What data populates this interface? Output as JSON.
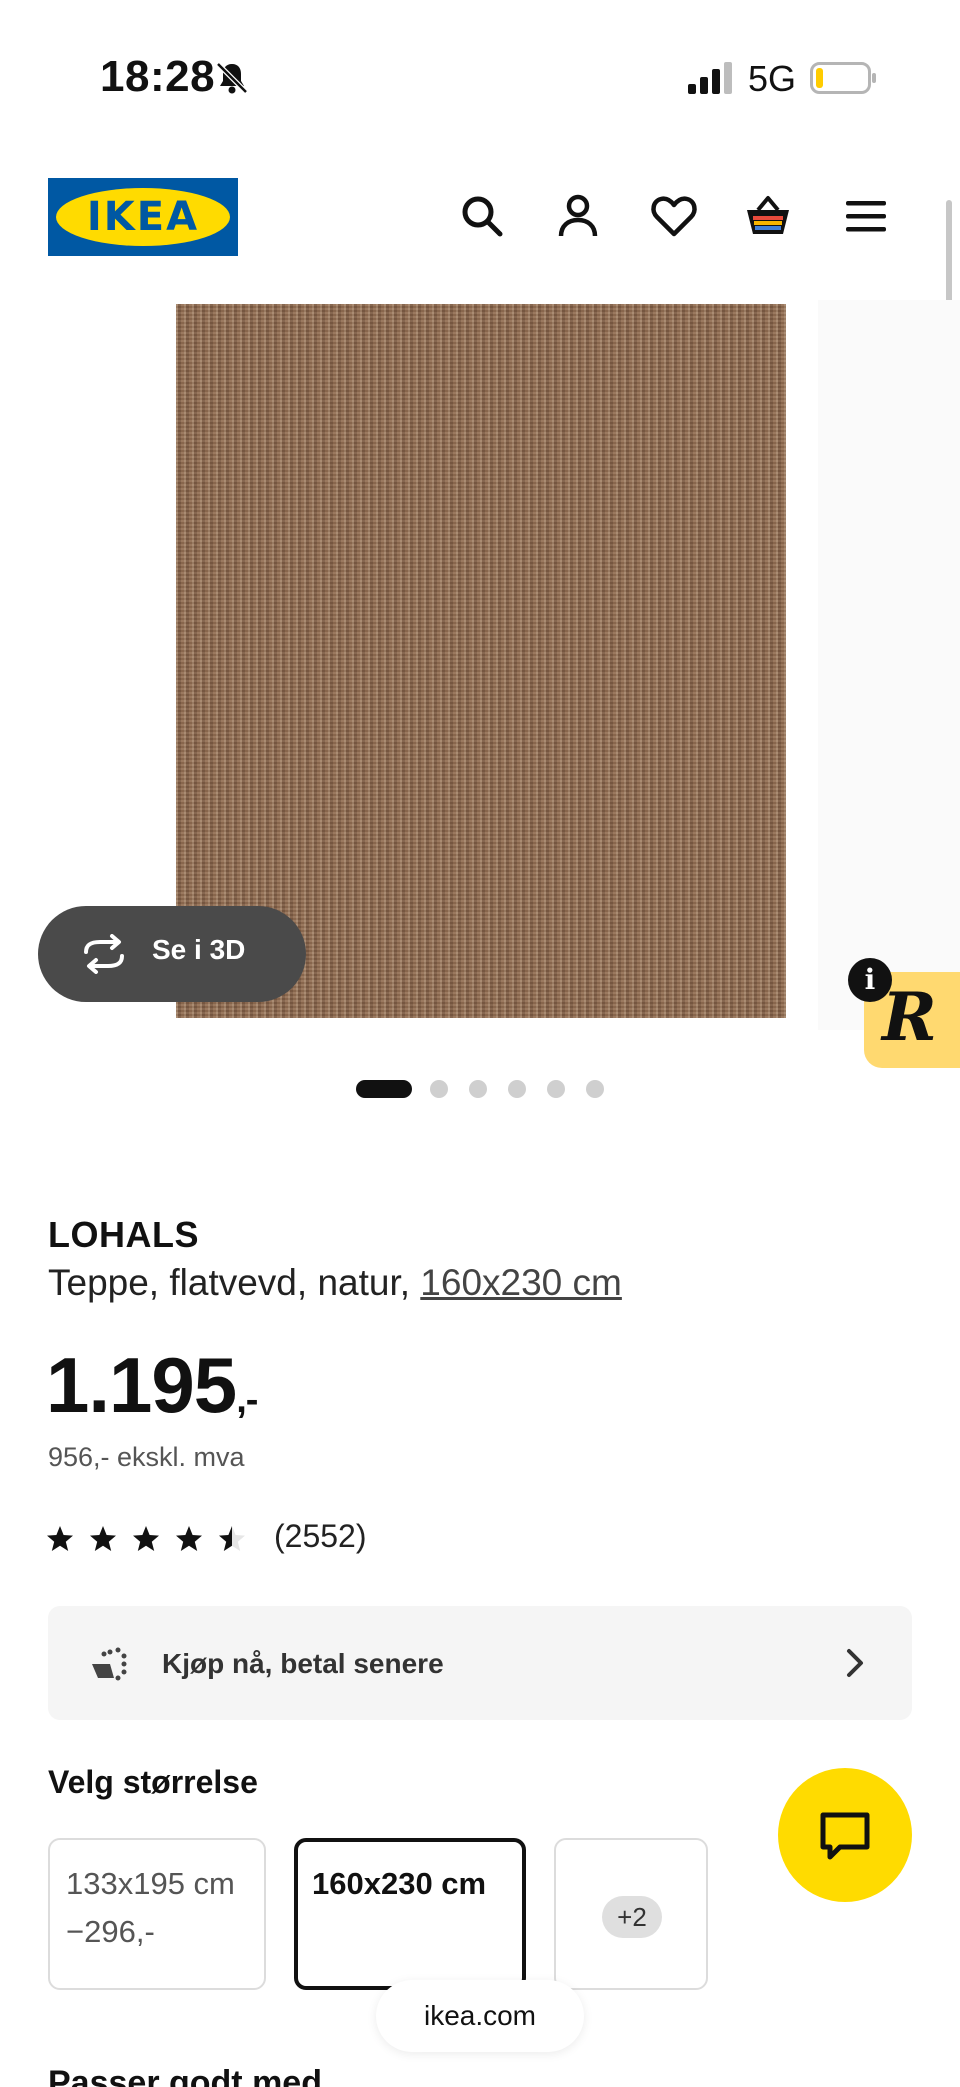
{
  "status_bar": {
    "time": "18:28",
    "network": "5G",
    "icons": [
      "bell-muted-icon",
      "signal-icon",
      "battery-icon"
    ]
  },
  "header": {
    "logo_text": "IKEA",
    "brand_colors": {
      "blue": "#0058a3",
      "yellow": "#ffdb00"
    },
    "icons": [
      "search-icon",
      "account-icon",
      "wishlist-heart-icon",
      "shopping-basket-icon",
      "menu-icon"
    ]
  },
  "gallery": {
    "view3d_label": "Se i 3D",
    "slide_count": 6,
    "active_slide": 1,
    "badge_letter": "R",
    "info_glyph": "i"
  },
  "product": {
    "name": "LOHALS",
    "description": "Teppe, flatvevd, natur,",
    "size_link": "160x230 cm",
    "price_main": "1.195",
    "price_suffix": ",-",
    "price_ex_vat": "956,- ekskl. mva",
    "rating": 4.5,
    "rating_max": 5,
    "reviews": "(2552)"
  },
  "payment": {
    "label": "Kjøp nå, betal senere"
  },
  "size_selector": {
    "title": "Velg størrelse",
    "options": [
      {
        "label": "133x195 cm",
        "price_diff": "−296,-"
      },
      {
        "label": "160x230 cm",
        "selected": true
      },
      {
        "label": "+2"
      }
    ]
  },
  "browser": {
    "url": "ikea.com"
  },
  "next_section": {
    "heading": "Passer godt med"
  }
}
